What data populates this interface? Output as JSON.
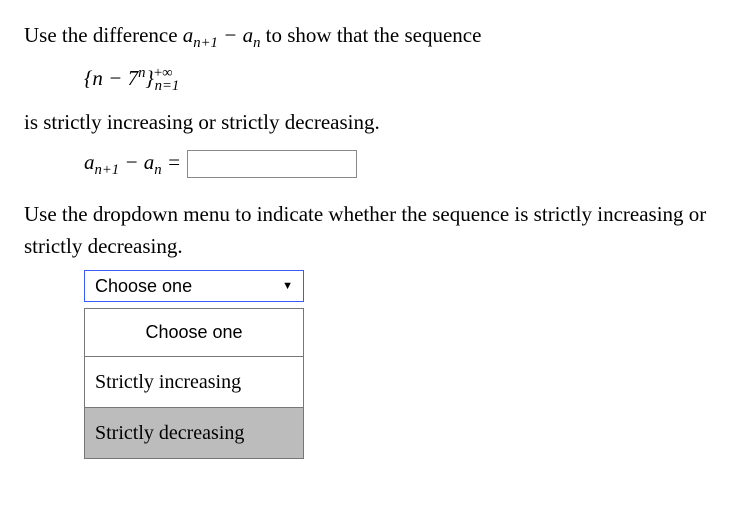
{
  "q1": {
    "intro_a": "Use the difference ",
    "diff_expr_html": "a_{n+1} - a_n",
    "intro_b": " to show that the sequence",
    "sequence_html": "{ n − 7^n }_{n=1}^{+∞}",
    "tail": "is strictly increasing or strictly decreasing."
  },
  "answer": {
    "lhs_html": "a_{n+1} - a_n =",
    "value": ""
  },
  "q2": {
    "text": "Use the dropdown menu to indicate whether the sequence is strictly increasing or strictly decreasing."
  },
  "dropdown": {
    "selected": "Choose one",
    "options": [
      "Choose one",
      "Strictly increasing",
      "Strictly decreasing"
    ]
  }
}
